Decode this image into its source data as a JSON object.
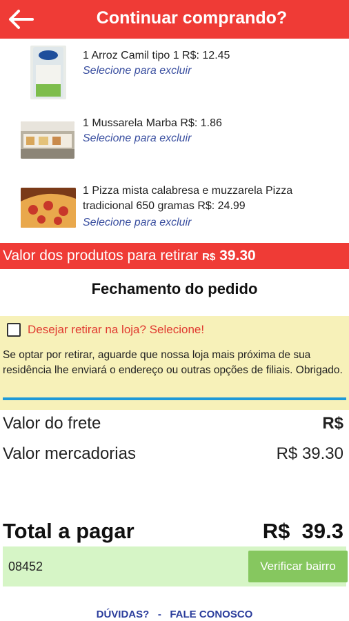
{
  "header": {
    "title": "Continuar comprando?",
    "back_icon": "arrow-left-icon"
  },
  "items": [
    {
      "text": "1 Arroz Camil tipo 1 R$: 12.45",
      "remove_label": "Selecione para excluir",
      "image": "rice-bag-image"
    },
    {
      "text": "1 Mussarela Marba R$: 1.86",
      "remove_label": "Selecione para excluir",
      "image": "deli-counter-image"
    },
    {
      "text": "1 Pizza mista calabresa e muzzarela Pizza tradicional 650 gramas R$: 24.99",
      "remove_label": "Selecione para excluir",
      "image": "pizza-image"
    }
  ],
  "summary": {
    "label": "Valor dos produtos para retirar",
    "currency": "R$",
    "amount": "39.30"
  },
  "checkout": {
    "title": "Fechamento do pedido",
    "pickup_label": "Desejar retirar na loja? Selecione!",
    "pickup_note": "Se optar por retirar, aguarde que nossa loja mais próxima de sua residência lhe enviará o endereço ou outras opções de filiais. Obrigado.",
    "freight_label": "Valor do frete",
    "freight_value": "R$",
    "goods_label": "Valor mercadorias",
    "goods_value": "R$ 39.30",
    "total_label": "Total a pagar",
    "total_value": "R$  39.3"
  },
  "cep": {
    "value": "08452",
    "button_label": "Verificar bairro"
  },
  "footer": {
    "help": "DÚVIDAS?",
    "separator": "-",
    "contact": "FALE CONOSCO"
  },
  "colors": {
    "brand_red": "#ef3b36",
    "pickup_bg": "#f7f1b9",
    "accent_blue": "#1e9ad8",
    "button_green": "#86c75f",
    "input_bg": "#d6f5c6"
  }
}
